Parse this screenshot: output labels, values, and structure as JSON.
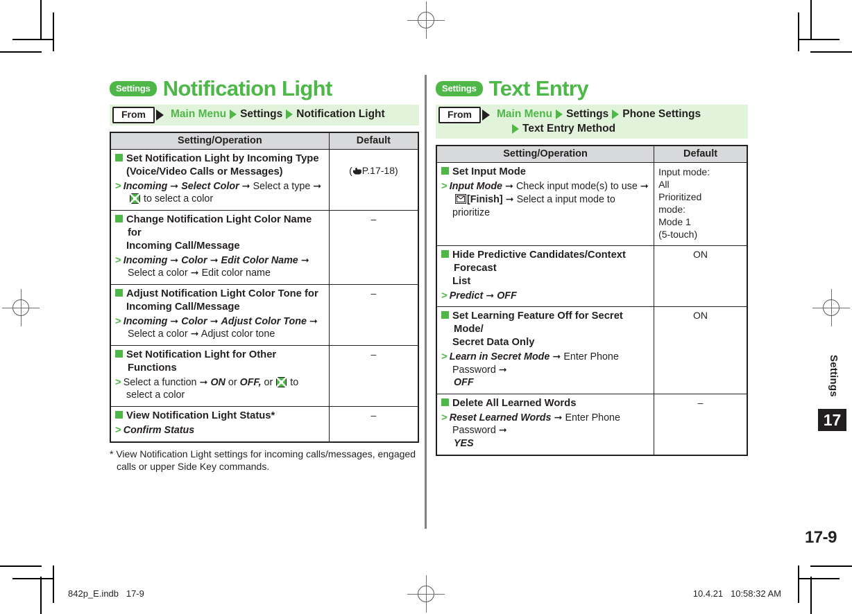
{
  "left_section": {
    "pill": "Settings",
    "title": "Notification Light",
    "from": {
      "button_label": "From",
      "crumbs_line1": [
        "Main Menu",
        "Settings",
        "Notification Light"
      ]
    },
    "table": {
      "headers": [
        "Setting/Operation",
        "Default"
      ],
      "rows": [
        {
          "title_line1": "Set Notification Light by Incoming Type",
          "title_line2": "(Voice/Video Calls or Messages)",
          "steps_a": "Incoming",
          "steps_b": "Select Color",
          "steps_c": "Select a type",
          "steps_d": "to select a color",
          "default": "(☞P.17-18)",
          "default_ref": "P.17-18"
        },
        {
          "title_line1": "Change Notification Light Color Name for",
          "title_line2": "Incoming Call/Message",
          "steps_a": "Incoming",
          "steps_b": "Color",
          "steps_c": "Edit Color Name",
          "steps_d": "Select a color",
          "steps_e": "Edit color name",
          "default": "–"
        },
        {
          "title_line1": "Adjust Notification Light Color Tone for",
          "title_line2": "Incoming Call/Message",
          "steps_a": "Incoming",
          "steps_b": "Color",
          "steps_c": "Adjust Color Tone",
          "steps_d": "Select a color",
          "steps_e": "Adjust color tone",
          "default": "–"
        },
        {
          "title_line1": "Set Notification Light for Other Functions",
          "steps_a": "Select a function",
          "steps_b": "ON",
          "steps_or1": "or",
          "steps_c": "OFF,",
          "steps_or2": "or",
          "steps_d": "to select a color",
          "default": "–"
        },
        {
          "title_line1": "View Notification Light Status*",
          "steps_a": "Confirm Status",
          "default": "–"
        }
      ]
    },
    "footnote": "* View Notification Light settings for incoming calls/messages, engaged calls or upper Side Key commands."
  },
  "right_section": {
    "pill": "Settings",
    "title": "Text Entry",
    "from": {
      "button_label": "From",
      "crumbs_line1": [
        "Main Menu",
        "Settings",
        "Phone Settings"
      ],
      "crumbs_line2": [
        "Text Entry Method"
      ]
    },
    "table": {
      "headers": [
        "Setting/Operation",
        "Default"
      ],
      "rows": [
        {
          "title_line1": "Set Input Mode",
          "steps_a": "Input Mode",
          "steps_b": "Check input mode(s) to use",
          "steps_c": "[Finish]",
          "steps_d": "Select a input mode to prioritize",
          "default": "Input mode:\nAll\nPrioritized\nmode:\nMode 1\n(5-touch)"
        },
        {
          "title_line1": "Hide Predictive Candidates/Context Forecast",
          "title_line2": "List",
          "steps_a": "Predict",
          "steps_b": "OFF",
          "default": "ON"
        },
        {
          "title_line1": "Set Learning Feature Off for Secret Mode/",
          "title_line2": "Secret Data Only",
          "steps_a": "Learn in Secret Mode",
          "steps_b": "Enter Phone Password",
          "steps_c": "OFF",
          "default": "ON"
        },
        {
          "title_line1": "Delete All Learned Words",
          "steps_a": "Reset Learned Words",
          "steps_b": "Enter Phone Password",
          "steps_c": "YES",
          "default": "–"
        }
      ]
    }
  },
  "side_tab": {
    "label": "Settings",
    "chapter": "17"
  },
  "folio": "17-9",
  "slug": {
    "left": "842p_E.indb   17-9",
    "right": "10.4.21   10:58:32 AM"
  },
  "colors": {
    "brand_green": "#4db847",
    "crumb_bg": "#e2f3dc",
    "header_gray": "#d8d9da",
    "ink": "#231f20"
  },
  "icons": {
    "nav_key": "nav-key-icon",
    "mail_key": "mail-key-icon",
    "hand": "pointing-hand-icon",
    "arrow": "right-arrow-icon"
  }
}
